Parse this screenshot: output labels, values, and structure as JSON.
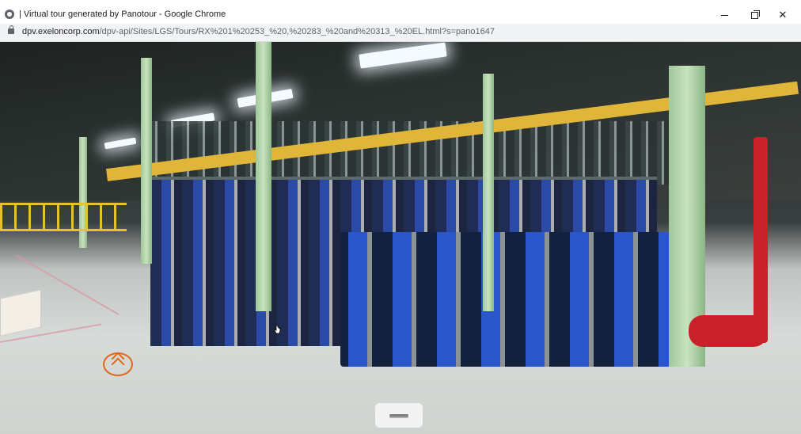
{
  "window": {
    "title": "| Virtual tour generated by Panotour - Google Chrome",
    "icon": "chrome-icon"
  },
  "address_bar": {
    "host": "dpv.exeloncorp.com",
    "path": "/dpv-api/Sites/LGS/Tours/RX%201%20253_%20,%20283_%20and%20313_%20EL.html?s=pano1647",
    "lock_icon": "lock-icon"
  },
  "window_controls": {
    "minimize": "minimize-icon",
    "maximize": "maximize-icon",
    "close": "close-icon"
  },
  "viewer": {
    "hotspot_icon": "double-chevron-up-icon",
    "control_icon": "menu-bar-icon",
    "colors": {
      "hotspot": "#e2661a",
      "beam": "#e0b63a",
      "pillar": "#b7d8ad",
      "tank": "#2b56c9",
      "red_pipe": "#c9202a"
    }
  }
}
